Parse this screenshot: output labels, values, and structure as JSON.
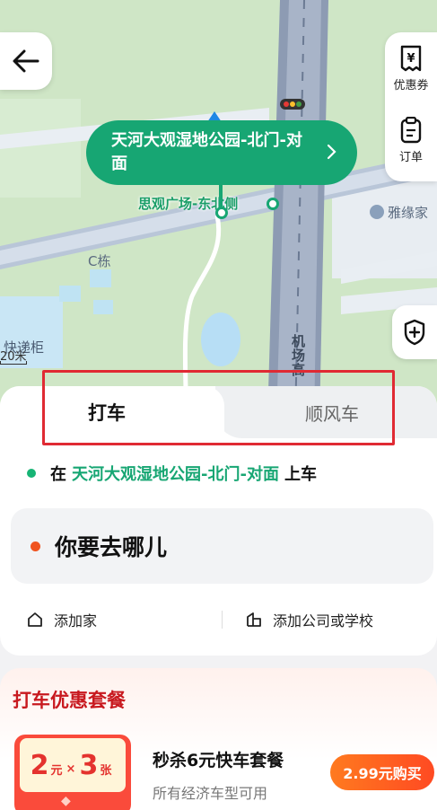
{
  "map": {
    "labels": {
      "building_c": "C栋",
      "express_cabinet": "快递柜",
      "road": "机场高",
      "store": "雅缘家",
      "plaza": "思观广场-东北侧"
    },
    "scale": "20米",
    "pickup_bubble": "天河大观湿地公园-北门-对面",
    "right_panel": {
      "coupon_label": "优惠券",
      "order_label": "订单"
    }
  },
  "tabs": {
    "active": "打车",
    "inactive": "顺风车"
  },
  "pickup": {
    "prefix": "在",
    "place": "天河大观湿地公园-北门-对面",
    "suffix": "上车"
  },
  "destination": {
    "placeholder": "你要去哪儿"
  },
  "shortcuts": {
    "home": "添加家",
    "work": "添加公司或学校"
  },
  "promo": {
    "title": "打车优惠套餐",
    "coupon": {
      "amount": "2",
      "unit": "元",
      "times": "×",
      "count": "3",
      "count_unit": "张"
    },
    "deal_title": "秒杀6元快车套餐",
    "deal_sub": "所有经济车型可用",
    "buy_label": "2.99元购买"
  },
  "colors": {
    "accent": "#17a673",
    "promo_red": "#c8191f",
    "buy_orange": "#ff5a22",
    "highlight": "#e02a33"
  }
}
